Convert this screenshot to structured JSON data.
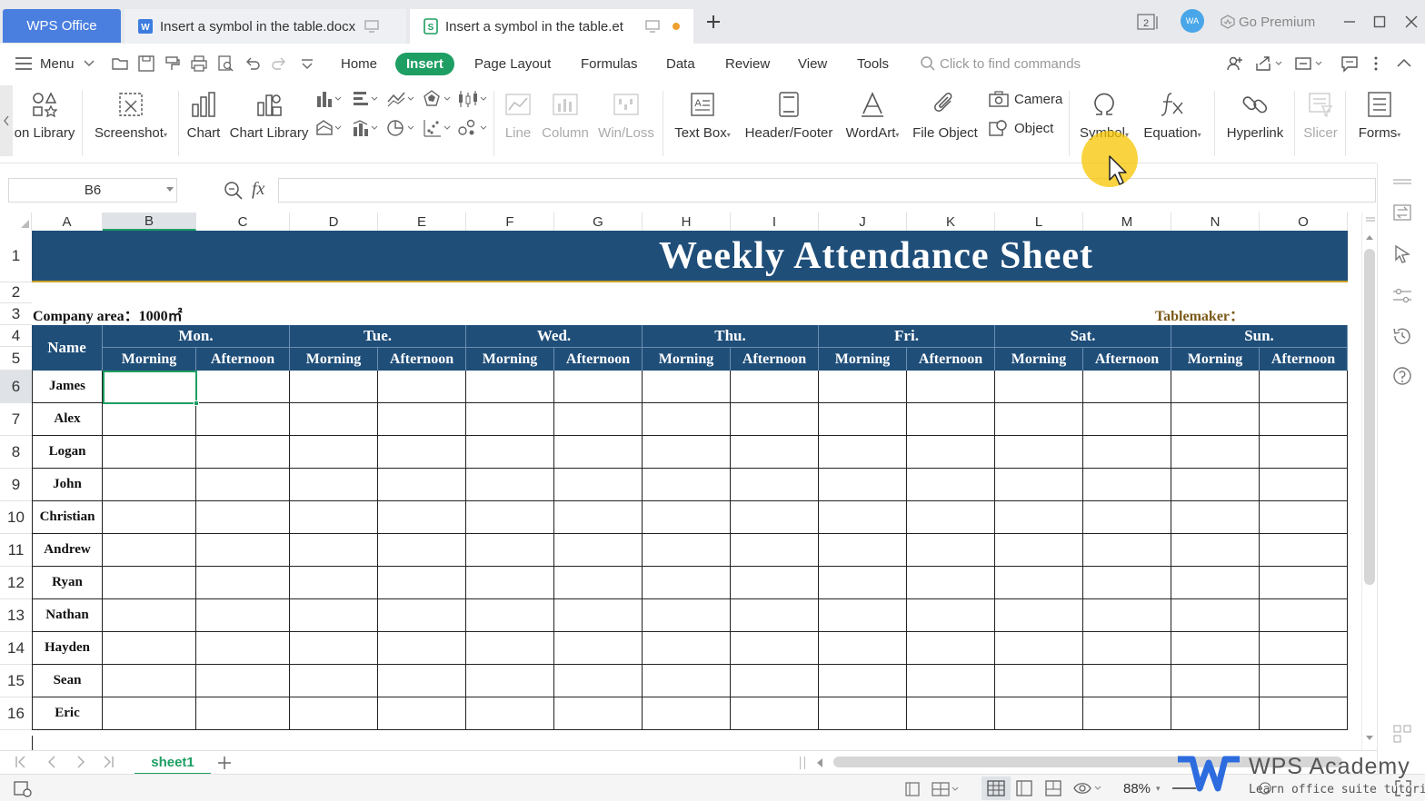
{
  "tabbar": {
    "wps_office": "WPS Office",
    "tab1_title": "Insert a symbol in the table.docx",
    "tab2_title": "Insert a symbol in the table.et",
    "avatar": "WA",
    "go_premium": "Go Premium",
    "page_badge": "2"
  },
  "menu": {
    "menu_label": "Menu",
    "tabs": [
      "Home",
      "Insert",
      "Page Layout",
      "Formulas",
      "Data",
      "Review",
      "View",
      "Tools"
    ],
    "search_placeholder": "Click to find commands"
  },
  "toolbar": {
    "icon_library": "on Library",
    "screenshot": "Screenshot",
    "chart": "Chart",
    "chart_library": "Chart Library",
    "line": "Line",
    "column": "Column",
    "winloss": "Win/Loss",
    "text_box": "Text Box",
    "header_footer": "Header/Footer",
    "wordart": "WordArt",
    "file_object": "File Object",
    "camera": "Camera",
    "object": "Object",
    "symbol": "Symbol",
    "equation": "Equation",
    "hyperlink": "Hyperlink",
    "slicer": "Slicer",
    "forms": "Forms"
  },
  "formula_bar": {
    "name_box": "B6",
    "fx": "fx",
    "formula": ""
  },
  "sheet": {
    "columns": [
      "A",
      "B",
      "C",
      "D",
      "E",
      "F",
      "G",
      "H",
      "I",
      "J",
      "K",
      "L",
      "M",
      "N",
      "O"
    ],
    "rows": [
      "1",
      "2",
      "3",
      "4",
      "5",
      "6",
      "7",
      "8",
      "9",
      "10",
      "11",
      "12",
      "13",
      "14",
      "15",
      "16"
    ],
    "title": "Weekly Attendance Sheet",
    "company_area": "Company area：1000㎡",
    "tablemaker": "Tablemaker：",
    "name_header": "Name",
    "days": [
      "Mon.",
      "Tue.",
      "Wed.",
      "Thu.",
      "Fri.",
      "Sat.",
      "Sun."
    ],
    "morning": "Morning",
    "afternoon": "Afternoon",
    "names": [
      "James",
      "Alex",
      "Logan",
      "John",
      "Christian",
      "Andrew",
      "Ryan",
      "Nathan",
      "Hayden",
      "Sean",
      "Eric"
    ],
    "header_color": "#1f4e79",
    "selected_cell": "B6"
  },
  "sheet_tabs": {
    "active": "sheet1"
  },
  "status": {
    "zoom": "88%"
  },
  "watermark": {
    "brand": "WPS Academy",
    "tagline": "Learn office suite tutorials"
  },
  "colors": {
    "accent_green": "#1e9e62",
    "tab_blue": "#4a7fe0",
    "cursor_highlight": "#f7c600"
  }
}
